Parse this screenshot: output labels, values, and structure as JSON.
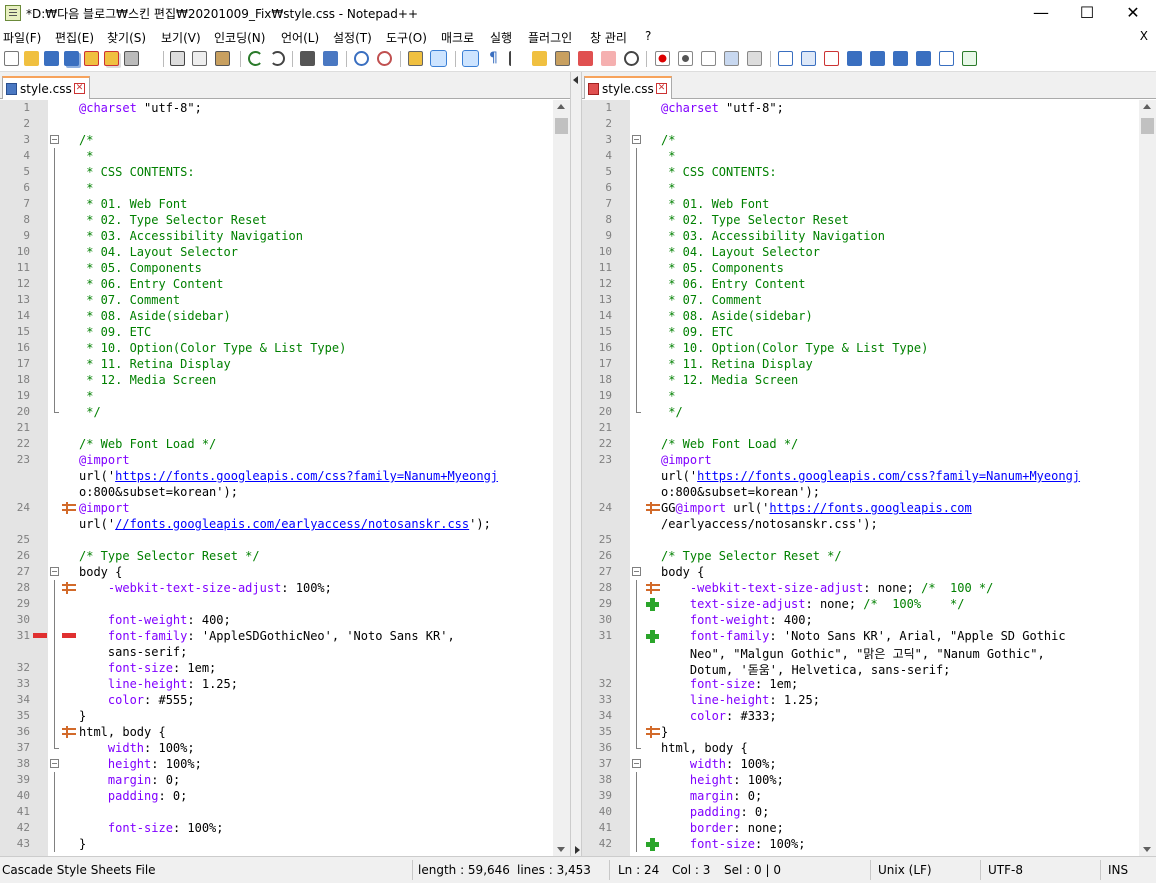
{
  "window": {
    "title": "*D:₩다음 블로그₩스킨 편집₩20201009_Fix₩style.css - Notepad++",
    "minimize": "—",
    "maximize": "☐",
    "close": "✕"
  },
  "menu": {
    "items": [
      "파일(F)",
      "편집(E)",
      "찾기(S)",
      "보기(V)",
      "인코딩(N)",
      "언어(L)",
      "설정(T)",
      "도구(O)",
      "매크로",
      "실행",
      "플러그인",
      "창 관리",
      "?"
    ],
    "close": "X"
  },
  "toolbar": {
    "icons": [
      "new-file-icon",
      "open-file-icon",
      "save-icon",
      "save-all-icon",
      "close-icon",
      "close-all-icon",
      "print-icon",
      "cut-icon",
      "copy-icon",
      "paste-icon",
      "undo-icon",
      "redo-icon",
      "find-icon",
      "replace-icon",
      "zoom-in-icon",
      "zoom-out-icon",
      "sync-vertical-icon",
      "sync-horizontal-icon",
      "word-wrap-icon",
      "show-all-chars-icon",
      "indent-guide-icon",
      "udl-icon",
      "doc-map-icon",
      "function-list-icon",
      "folder-as-workspace-icon",
      "monitoring-icon",
      "record-macro-icon",
      "stop-macro-icon",
      "play-macro-icon",
      "run-macro-multiple-icon",
      "save-macro-icon",
      "compare-icon",
      "compare-clear-icon",
      "compare-nav-first-icon",
      "compare-nav-prev-icon",
      "compare-nav-next-icon",
      "compare-nav-last-icon",
      "compare-options-icon",
      "compare-sync-icon"
    ]
  },
  "left_pane": {
    "tab_label": "style.css",
    "lines": [
      {
        "n": "1",
        "t": "@charset \"utf-8\";"
      },
      {
        "n": "2",
        "t": ""
      },
      {
        "n": "3",
        "t": "/*"
      },
      {
        "n": "4",
        "t": " *"
      },
      {
        "n": "5",
        "t": " * CSS CONTENTS:"
      },
      {
        "n": "6",
        "t": " *"
      },
      {
        "n": "7",
        "t": " * 01. Web Font"
      },
      {
        "n": "8",
        "t": " * 02. Type Selector Reset"
      },
      {
        "n": "9",
        "t": " * 03. Accessibility Navigation"
      },
      {
        "n": "10",
        "t": " * 04. Layout Selector"
      },
      {
        "n": "11",
        "t": " * 05. Components"
      },
      {
        "n": "12",
        "t": " * 06. Entry Content"
      },
      {
        "n": "13",
        "t": " * 07. Comment"
      },
      {
        "n": "14",
        "t": " * 08. Aside(sidebar)"
      },
      {
        "n": "15",
        "t": " * 09. ETC"
      },
      {
        "n": "16",
        "t": " * 10. Option(Color Type & List Type)"
      },
      {
        "n": "17",
        "t": " * 11. Retina Display"
      },
      {
        "n": "18",
        "t": " * 12. Media Screen"
      },
      {
        "n": "19",
        "t": " *"
      },
      {
        "n": "20",
        "t": " */"
      },
      {
        "n": "21",
        "t": ""
      },
      {
        "n": "22",
        "t": "/* Web Font Load */"
      },
      {
        "n": "23",
        "t": "@import"
      },
      {
        "n": "",
        "t": "url('https://fonts.googleapis.com/css?family=Nanum+Myeongj"
      },
      {
        "n": "",
        "t": "o:800&subset=korean');"
      },
      {
        "n": "24",
        "t": "@import"
      },
      {
        "n": "",
        "t": "url('//fonts.googleapis.com/earlyaccess/notosanskr.css');"
      },
      {
        "n": "25",
        "t": ""
      },
      {
        "n": "26",
        "t": "/* Type Selector Reset */"
      },
      {
        "n": "27",
        "t": "body {"
      },
      {
        "n": "28",
        "t": "    -webkit-text-size-adjust: 100%;"
      },
      {
        "n": "29",
        "t": ""
      },
      {
        "n": "30",
        "t": "    font-weight: 400;"
      },
      {
        "n": "31",
        "t": "    font-family: 'AppleSDGothicNeo', 'Noto Sans KR',"
      },
      {
        "n": "",
        "t": "    sans-serif;"
      },
      {
        "n": "32",
        "t": "    font-size: 1em;"
      },
      {
        "n": "33",
        "t": "    line-height: 1.25;"
      },
      {
        "n": "34",
        "t": "    color: #555;"
      },
      {
        "n": "35",
        "t": "}"
      },
      {
        "n": "36",
        "t": "html, body {"
      },
      {
        "n": "37",
        "t": "    width: 100%;"
      },
      {
        "n": "38",
        "t": "    height: 100%;"
      },
      {
        "n": "39",
        "t": "    margin: 0;"
      },
      {
        "n": "40",
        "t": "    padding: 0;"
      },
      {
        "n": "41",
        "t": ""
      },
      {
        "n": "42",
        "t": "    font-size: 100%;"
      },
      {
        "n": "43",
        "t": "}"
      }
    ]
  },
  "right_pane": {
    "tab_label": "style.css",
    "lines": [
      {
        "n": "1",
        "t": "@charset \"utf-8\";"
      },
      {
        "n": "2",
        "t": ""
      },
      {
        "n": "3",
        "t": "/*"
      },
      {
        "n": "4",
        "t": " *"
      },
      {
        "n": "5",
        "t": " * CSS CONTENTS:"
      },
      {
        "n": "6",
        "t": " *"
      },
      {
        "n": "7",
        "t": " * 01. Web Font"
      },
      {
        "n": "8",
        "t": " * 02. Type Selector Reset"
      },
      {
        "n": "9",
        "t": " * 03. Accessibility Navigation"
      },
      {
        "n": "10",
        "t": " * 04. Layout Selector"
      },
      {
        "n": "11",
        "t": " * 05. Components"
      },
      {
        "n": "12",
        "t": " * 06. Entry Content"
      },
      {
        "n": "13",
        "t": " * 07. Comment"
      },
      {
        "n": "14",
        "t": " * 08. Aside(sidebar)"
      },
      {
        "n": "15",
        "t": " * 09. ETC"
      },
      {
        "n": "16",
        "t": " * 10. Option(Color Type & List Type)"
      },
      {
        "n": "17",
        "t": " * 11. Retina Display"
      },
      {
        "n": "18",
        "t": " * 12. Media Screen"
      },
      {
        "n": "19",
        "t": " *"
      },
      {
        "n": "20",
        "t": " */"
      },
      {
        "n": "21",
        "t": ""
      },
      {
        "n": "22",
        "t": "/* Web Font Load */"
      },
      {
        "n": "23",
        "t": "@import"
      },
      {
        "n": "",
        "t": "url('https://fonts.googleapis.com/css?family=Nanum+Myeongj"
      },
      {
        "n": "",
        "t": "o:800&subset=korean');"
      },
      {
        "n": "24",
        "t": "GG@import url('https://fonts.googleapis.com"
      },
      {
        "n": "",
        "t": "/earlyaccess/notosanskr.css');"
      },
      {
        "n": "25",
        "t": ""
      },
      {
        "n": "26",
        "t": "/* Type Selector Reset */"
      },
      {
        "n": "27",
        "t": "body {"
      },
      {
        "n": "28",
        "t": "    -webkit-text-size-adjust: none; /*  100 */"
      },
      {
        "n": "29",
        "t": "    text-size-adjust: none; /*  100%    */"
      },
      {
        "n": "30",
        "t": "    font-weight: 400;"
      },
      {
        "n": "31",
        "t": "    font-family: 'Noto Sans KR', Arial, \"Apple SD Gothic"
      },
      {
        "n": "",
        "t": "    Neo\", \"Malgun Gothic\", \"맑은 고딕\", \"Nanum Gothic\","
      },
      {
        "n": "",
        "t": "    Dotum, '돋움', Helvetica, sans-serif;"
      },
      {
        "n": "32",
        "t": "    font-size: 1em;"
      },
      {
        "n": "33",
        "t": "    line-height: 1.25;"
      },
      {
        "n": "34",
        "t": "    color: #333;"
      },
      {
        "n": "35",
        "t": "}"
      },
      {
        "n": "36",
        "t": "html, body {"
      },
      {
        "n": "37",
        "t": "    width: 100%;"
      },
      {
        "n": "38",
        "t": "    height: 100%;"
      },
      {
        "n": "39",
        "t": "    margin: 0;"
      },
      {
        "n": "40",
        "t": "    padding: 0;"
      },
      {
        "n": "41",
        "t": "    border: none;"
      },
      {
        "n": "42",
        "t": "    font-size: 100%;"
      }
    ]
  },
  "status": {
    "file_type": "Cascade Style Sheets File",
    "length": "length : 59,646",
    "lines": "lines : 3,453",
    "ln": "Ln : 24",
    "col": "Col : 3",
    "sel": "Sel : 0 | 0",
    "eol": "Unix (LF)",
    "encoding": "UTF-8",
    "mode": "INS"
  },
  "colors": {
    "changed_bg": "#e6e0b8",
    "removed_bg": "#f8d4d4",
    "added_bg": "#dff8df",
    "blank_bg": "#e2e2e2",
    "comment": "#008000",
    "tab_accent": "#f7a35c"
  }
}
